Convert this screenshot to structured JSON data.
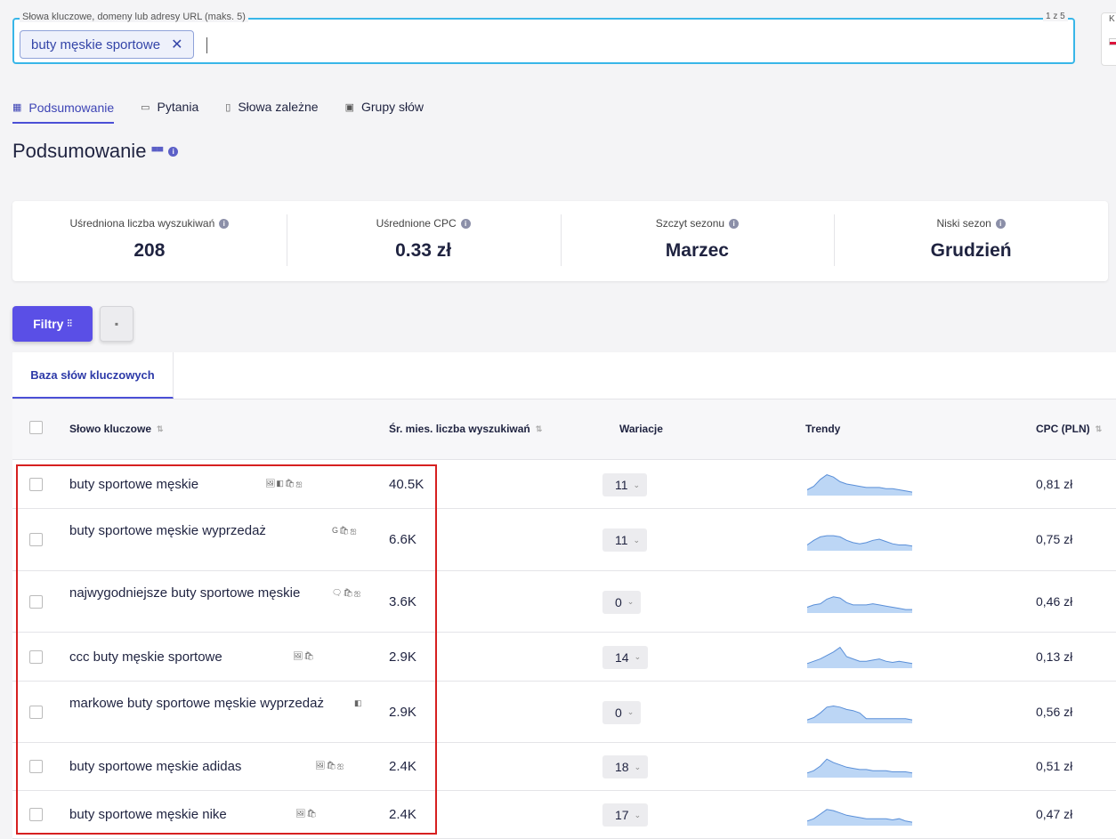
{
  "search": {
    "legend": "Słowa kluczowe, domeny lub adresy URL (maks. 5)",
    "count": "1 z 5",
    "chip": "buty męskie sportowe",
    "corner_letter": "K"
  },
  "tabs": [
    {
      "label": "Podsumowanie",
      "icon": "dashboard-icon",
      "active": true
    },
    {
      "label": "Pytania",
      "icon": "chat-icon"
    },
    {
      "label": "Słowa zależne",
      "icon": "document-icon"
    },
    {
      "label": "Grupy słów",
      "icon": "group-icon"
    }
  ],
  "title": "Podsumowanie",
  "stats": [
    {
      "label": "Uśredniona liczba wyszukiwań",
      "value": "208"
    },
    {
      "label": "Uśrednione CPC",
      "value": "0.33 zł"
    },
    {
      "label": "Szczyt sezonu",
      "value": "Marzec"
    },
    {
      "label": "Niski sezon",
      "value": "Grudzień"
    }
  ],
  "filter_label": "Filtry",
  "panel_tab": "Baza słów kluczowych",
  "columns": {
    "keyword": "Słowo kluczowe",
    "volume": "Śr. mies. liczba wyszukiwań",
    "variations": "Wariacje",
    "trends": "Trendy",
    "cpc": "CPC (PLN)"
  },
  "rows": [
    {
      "keyword": "buty sportowe męskie",
      "icons": "🖼◧🛍ஐ",
      "volume": "40.5K",
      "variations": "11",
      "cpc": "0,81 zł",
      "trend": [
        5,
        8,
        14,
        18,
        16,
        12,
        10,
        9,
        8,
        7,
        7,
        7,
        6,
        6,
        5,
        4,
        3
      ]
    },
    {
      "keyword": "buty sportowe męskie wyprzedaż",
      "icons": "G🛍ஐ",
      "volume": "6.6K",
      "variations": "11",
      "cpc": "0,75 zł",
      "trend": [
        5,
        9,
        12,
        13,
        13,
        12,
        9,
        7,
        6,
        7,
        9,
        10,
        8,
        6,
        5,
        5,
        4
      ]
    },
    {
      "keyword": "najwygodniejsze buty sportowe męskie",
      "icons": "🗨🛍ஐ",
      "volume": "3.6K",
      "variations": "0",
      "cpc": "0,46 zł",
      "trend": [
        5,
        7,
        8,
        12,
        14,
        13,
        9,
        7,
        7,
        7,
        8,
        7,
        6,
        5,
        4,
        3,
        3
      ]
    },
    {
      "keyword": "ccc buty męskie sportowe",
      "icons": "🖼🛍",
      "volume": "2.9K",
      "variations": "14",
      "cpc": "0,13 zł",
      "trend": [
        4,
        6,
        8,
        11,
        14,
        18,
        10,
        8,
        6,
        6,
        7,
        8,
        6,
        5,
        6,
        5,
        4
      ]
    },
    {
      "keyword": "markowe buty sportowe męskie wyprzedaż",
      "icons": "◧",
      "volume": "2.9K",
      "variations": "0",
      "cpc": "0,56 zł",
      "trend": [
        3,
        5,
        9,
        14,
        15,
        14,
        12,
        11,
        9,
        4,
        4,
        4,
        4,
        4,
        4,
        4,
        3
      ]
    },
    {
      "keyword": "buty sportowe męskie adidas",
      "icons": "🖼🛍ஐ",
      "volume": "2.4K",
      "variations": "18",
      "cpc": "0,51 zł",
      "trend": [
        4,
        6,
        10,
        16,
        13,
        11,
        9,
        8,
        7,
        7,
        6,
        6,
        6,
        5,
        5,
        5,
        4
      ]
    },
    {
      "keyword": "buty sportowe męskie nike",
      "icons": "🖼🛍",
      "volume": "2.4K",
      "variations": "17",
      "cpc": "0,47 zł",
      "trend": [
        4,
        6,
        10,
        14,
        13,
        11,
        9,
        8,
        7,
        6,
        6,
        6,
        6,
        5,
        6,
        4,
        3
      ]
    }
  ],
  "colors": {
    "accent": "#5a4fe6",
    "highlight": "#d62020",
    "search_border": "#38b6e8",
    "trend_fill": "#bcd6f5",
    "trend_line": "#5a8fd8"
  }
}
